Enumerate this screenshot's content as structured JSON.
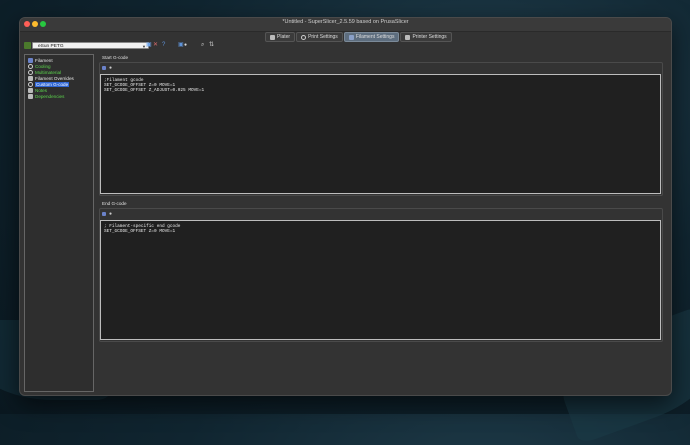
{
  "window": {
    "title": "*Untitled - SuperSlicer_2.5.59  based on PrusaSlicer"
  },
  "tabs": [
    {
      "label": "Plater",
      "icon": "plater-icon",
      "active": false
    },
    {
      "label": "Print Settings",
      "icon": "print-settings-icon",
      "active": false
    },
    {
      "label": "Filament Settings",
      "icon": "filament-settings-icon",
      "active": true
    },
    {
      "label": "Printer Settings",
      "icon": "printer-settings-icon",
      "active": false
    }
  ],
  "toolbar": {
    "profile_value": "eSun PETG",
    "icons": [
      "save-icon",
      "delete-icon",
      "help-icon",
      "mode-icon",
      "search-icon",
      "compare-icon"
    ]
  },
  "sidebar": {
    "items": [
      {
        "label": "Filament",
        "icon": "filament-page-icon",
        "color": "#e8e8e8"
      },
      {
        "label": "Cooling",
        "icon": "cooling-page-icon",
        "color": "#5bd44c"
      },
      {
        "label": "Multimaterial",
        "icon": "multimaterial-page-icon",
        "color": "#5bd44c"
      },
      {
        "label": "Filament Overrides",
        "icon": "filament-overrides-page-icon",
        "color": "#e8e8e8"
      },
      {
        "label": "Custom G-code",
        "icon": "custom-gcode-page-icon",
        "color": "#ffffff",
        "selected": true
      },
      {
        "label": "Notes",
        "icon": "notes-page-icon",
        "color": "#5bd44c"
      },
      {
        "label": "Dependencies",
        "icon": "dependencies-page-icon",
        "color": "#5bd44c"
      }
    ]
  },
  "start_gcode": {
    "title": "Start G-code",
    "lines": [
      ";Filament gcode",
      "SET_GCODE_OFFSET Z=0 MOVE=1",
      "SET_GCODE_OFFSET Z_ADJUST=0.025 MOVE=1"
    ]
  },
  "end_gcode": {
    "title": "End G-code",
    "lines": [
      "; Filament-specific end gcode",
      "SET_GCODE_OFFSET Z=0 MOVE=1"
    ]
  },
  "colors": {
    "accent": "#2f66d5",
    "active_tab": "#5d6d7e",
    "green_label": "#5bd44c"
  }
}
